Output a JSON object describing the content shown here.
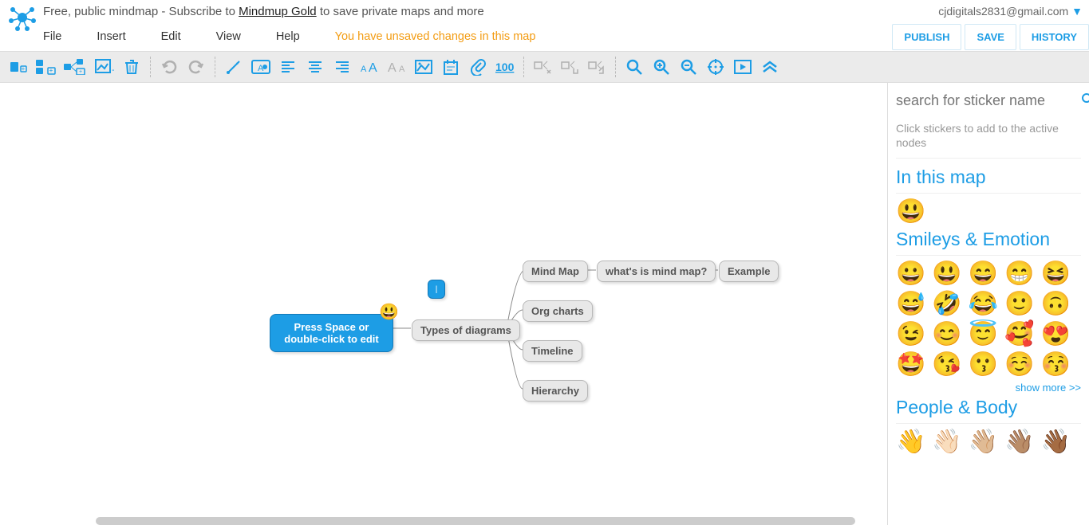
{
  "header": {
    "message_prefix": "Free, public mindmap - Subscribe to ",
    "gold_link": "Mindmup Gold",
    "message_suffix": " to save private maps and more",
    "email": "cjdigitals2831@gmail.com"
  },
  "menu": {
    "file": "File",
    "insert": "Insert",
    "edit": "Edit",
    "view": "View",
    "help": "Help",
    "unsaved": "You have unsaved changes in this map",
    "publish": "PUBLISH",
    "save": "SAVE",
    "history": "HISTORY"
  },
  "toolbar_icons": {
    "add_child": "add-child",
    "add_sibling": "add-sibling",
    "add_parent": "add-parent",
    "add_image": "add-image",
    "delete": "delete",
    "undo": "undo",
    "redo": "redo",
    "line": "line",
    "node_style": "node-style",
    "align_left": "align-left",
    "align_center": "align-center",
    "align_right": "align-right",
    "text_bigger": "text-bigger",
    "text_smaller": "text-smaller",
    "image": "image",
    "note": "note",
    "attach": "attach",
    "measure": "measure",
    "cut": "cut",
    "copy": "copy",
    "paste": "paste",
    "search": "search",
    "zoom_in": "zoom-in",
    "zoom_out": "zoom-out",
    "center": "center",
    "present": "present",
    "collapse": "collapse"
  },
  "mindmap": {
    "root": "Press Space or double-click to edit",
    "types": "Types of diagrams",
    "mindmap": "Mind Map",
    "what": "what's is mind map?",
    "example": "Example",
    "org": "Org charts",
    "timeline": "Timeline",
    "hierarchy": "Hierarchy",
    "root_emoji": "😃"
  },
  "panel": {
    "search_placeholder": "search for sticker name",
    "hint": "Click stickers to add to the active nodes",
    "section_in_map": "In this map",
    "section_smileys": "Smileys & Emotion",
    "section_people": "People & Body",
    "show_more": "show more >>",
    "in_map_emojis": [
      "😃"
    ],
    "smiley_emojis": [
      "😀",
      "😃",
      "😄",
      "😁",
      "😆",
      "😅",
      "🤣",
      "😂",
      "🙂",
      "🙃",
      "😉",
      "😊",
      "😇",
      "🥰",
      "😍",
      "🤩",
      "😘",
      "😗",
      "☺️",
      "😚"
    ],
    "people_emojis": [
      "👋",
      "👋🏻",
      "👋🏼",
      "👋🏽",
      "👋🏾"
    ]
  }
}
